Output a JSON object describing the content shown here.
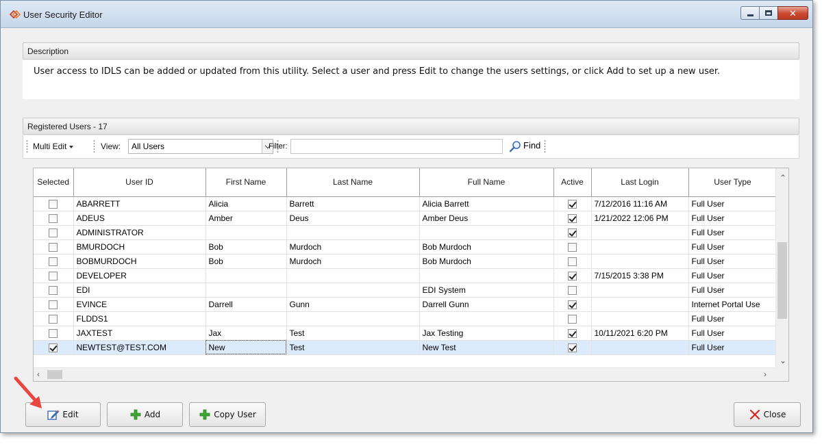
{
  "window": {
    "title": "User Security Editor"
  },
  "description": {
    "header": "Description",
    "text": "User access to IDLS can be added or updated from this utility.  Select a user and press Edit to change the users settings, or click Add to set up a new user."
  },
  "registered_users": {
    "header": "Registered Users - 17"
  },
  "toolbar": {
    "multi_edit_label": "Multi Edit",
    "view_label": "View:",
    "view_value": "All Users",
    "filter_label": "Filter:",
    "filter_value": "",
    "find_label": "Find"
  },
  "grid": {
    "columns": [
      "Selected",
      "User ID",
      "First Name",
      "Last Name",
      "Full Name",
      "Active",
      "Last Login",
      "User Type"
    ],
    "rows": [
      {
        "selected": false,
        "user_id": "ABARRETT",
        "first_name": "Alicia",
        "last_name": "Barrett",
        "full_name": "Alicia Barrett",
        "active": true,
        "last_login": "7/12/2016 11:16 AM",
        "user_type": "Full User"
      },
      {
        "selected": false,
        "user_id": "ADEUS",
        "first_name": "Amber",
        "last_name": "Deus",
        "full_name": "Amber Deus",
        "active": true,
        "last_login": "1/21/2022 12:06 PM",
        "user_type": "Full User"
      },
      {
        "selected": false,
        "user_id": "ADMINISTRATOR",
        "first_name": "",
        "last_name": "",
        "full_name": "",
        "active": true,
        "last_login": "",
        "user_type": "Full User"
      },
      {
        "selected": false,
        "user_id": "BMURDOCH",
        "first_name": "Bob",
        "last_name": "Murdoch",
        "full_name": "Bob Murdoch",
        "active": false,
        "last_login": "",
        "user_type": "Full User"
      },
      {
        "selected": false,
        "user_id": "BOBMURDOCH",
        "first_name": "Bob",
        "last_name": "Murdoch",
        "full_name": "Bob Murdoch",
        "active": false,
        "last_login": "",
        "user_type": "Full User"
      },
      {
        "selected": false,
        "user_id": "DEVELOPER",
        "first_name": "",
        "last_name": "",
        "full_name": "",
        "active": true,
        "last_login": "7/15/2015 3:38 PM",
        "user_type": "Full User"
      },
      {
        "selected": false,
        "user_id": "EDI",
        "first_name": "",
        "last_name": "",
        "full_name": "EDI System",
        "active": false,
        "last_login": "",
        "user_type": "Full User"
      },
      {
        "selected": false,
        "user_id": "EVINCE",
        "first_name": "Darrell",
        "last_name": "Gunn",
        "full_name": "Darrell Gunn",
        "active": true,
        "last_login": "",
        "user_type": "Internet Portal Use"
      },
      {
        "selected": false,
        "user_id": "FLDDS1",
        "first_name": "",
        "last_name": "",
        "full_name": "",
        "active": false,
        "last_login": "",
        "user_type": "Full User"
      },
      {
        "selected": false,
        "user_id": "JAXTEST",
        "first_name": "Jax",
        "last_name": "Test",
        "full_name": "Jax Testing",
        "active": true,
        "last_login": "10/11/2021 6:20 PM",
        "user_type": "Full User"
      },
      {
        "selected": true,
        "user_id": "NEWTEST@TEST.COM",
        "first_name": "New",
        "last_name": "Test",
        "full_name": "New Test",
        "active": true,
        "last_login": "",
        "user_type": "Full User"
      }
    ]
  },
  "buttons": {
    "edit": "Edit",
    "add": "Add",
    "copy_user": "Copy User",
    "close": "Close"
  },
  "colors": {
    "selected_row": "#dcebfc",
    "add_icon": "#3aa832",
    "close_icon": "#d9261c",
    "annotation_arrow": "#e8463f"
  }
}
